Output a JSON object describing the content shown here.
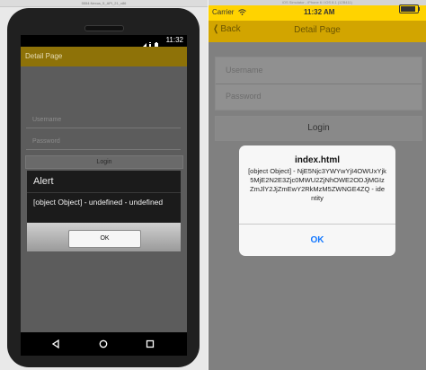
{
  "android": {
    "window_title": "5554:Nexus_5_API_21_x86",
    "status_time": "11:32",
    "action_bar_title": "Detail Page",
    "username_placeholder": "Username",
    "password_placeholder": "Password",
    "login_label": "Login",
    "alert": {
      "title": "Alert",
      "message": "[object Object] - undefined - undefined",
      "ok_label": "OK"
    }
  },
  "ios": {
    "window_title": "iOS Simulator - iPhone 6 / iOS 8.1 (12B411)",
    "carrier": "Carrier",
    "time": "11:32 AM",
    "back_label": "Back",
    "nav_title": "Detail Page",
    "username_placeholder": "Username",
    "password_placeholder": "Password",
    "login_label": "Login",
    "alert": {
      "title": "index.html",
      "message": "[object Object] - NjE5Njc3YWYwYjI4OWUxYjk5MjE2N2E3Zjc0MWU2ZjNhOWE2ODJjMGIzZmJlY2JjZmEwY2RkMzM5ZWNGE4ZQ - identity",
      "ok_label": "OK"
    }
  },
  "colors": {
    "android_action_bar": "#8e7208",
    "ios_status_bar": "#ffd300",
    "ios_nav_bar": "#d2a500",
    "ios_ok_blue": "#1478ff"
  }
}
